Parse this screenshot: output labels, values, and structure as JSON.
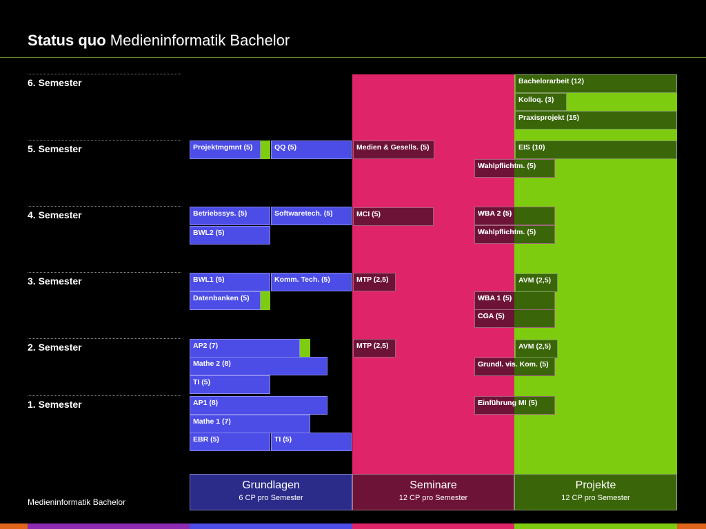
{
  "header": {
    "title_bold": "Status quo",
    "title_rest": "Medieninformatik Bachelor"
  },
  "semesters": [
    "6. Semester",
    "5. Semester",
    "4. Semester",
    "3. Semester",
    "2. Semester",
    "1. Semester"
  ],
  "grundlagen": {
    "s5_projektmgmnt": "Projektmgmnt (5)",
    "s5_qq": "QQ (5)",
    "s4_betriebssys": "Betriebssys. (5)",
    "s4_softwaretech": "Softwaretech. (5)",
    "s4_bwl2": "BWL2 (5)",
    "s3_bwl1": "BWL1 (5)",
    "s3_kommtech": "Komm. Tech. (5)",
    "s3_datenbanken": "Datenbanken (5)",
    "s2_ap2": "AP2 (7)",
    "s2_mathe2": "Mathe 2 (8)",
    "s2_ti": "TI (5)",
    "s1_ap1": "AP1 (8)",
    "s1_mathe1": "Mathe 1 (7)",
    "s1_ebr": "EBR (5)",
    "s1_ti": "TI (5)"
  },
  "seminare": {
    "s5_medien": "Medien & Gesells. (5)",
    "s5_wahlpflicht": "Wahlpflichtm. (5)",
    "s4_mci": "MCI (5)",
    "s4_wba2": "WBA 2 (5)",
    "s4_wahlpflicht": "Wahlpflichtm. (5)",
    "s3_mtp": "MTP (2,5)",
    "s3_wba1": "WBA 1 (5)",
    "s3_cga": "CGA (5)",
    "s2_mtp": "MTP (2,5)",
    "s2_grundl": "Grundl. vis. Kom. (5)",
    "s1_einfuehrung": "Einführung MI (5)"
  },
  "projekte": {
    "s6_bachelor": "Bachelorarbeit (12)",
    "s6_kolloq": "Kolloq. (3)",
    "s6_praxis": "Praxisprojekt (15)",
    "s5_eis": "EIS (10)",
    "s3_avm": "AVM (2,5)",
    "s2_avm": "AVM (2,5)"
  },
  "footer": {
    "grundlagen_title": "Grundlagen",
    "grundlagen_sub": "6 CP pro Semester",
    "seminare_title": "Seminare",
    "seminare_sub": "12 CP pro Semester",
    "projekte_title": "Projekte",
    "projekte_sub": "12 CP pro Semester",
    "bottom_label": "Medieninformatik Bachelor"
  },
  "colors": {
    "grundlagen": "#4c4ce6",
    "seminare": "#e0246a",
    "projekte": "#7dcc10",
    "seminare_box": "#6e1338",
    "projekte_box": "#3a6609"
  }
}
